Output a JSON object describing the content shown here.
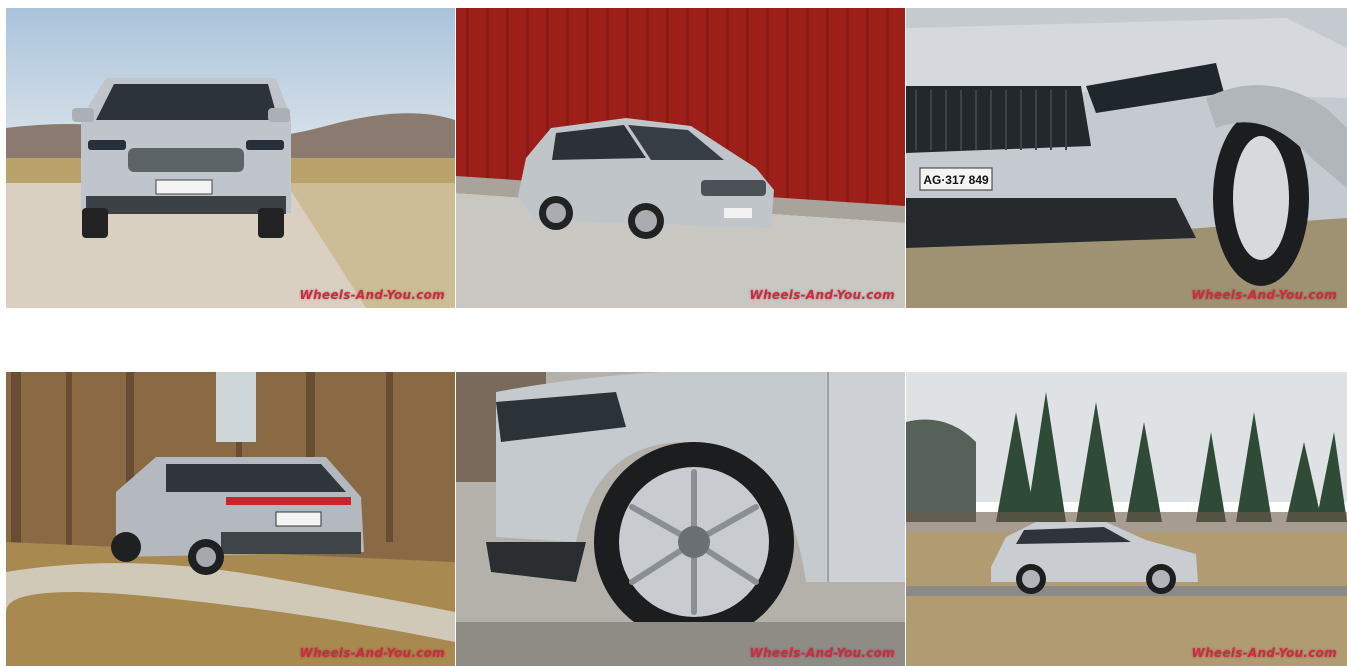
{
  "gallery": {
    "watermark": "Wheels-And-You.com",
    "photos": [
      {
        "subject": "silver SUV front view on gravel road",
        "watermark": "Wheels-And-You.com"
      },
      {
        "subject": "silver SUV three-quarter front view against red wall",
        "watermark": "Wheels-And-You.com"
      },
      {
        "subject": "close-up of front grille and headlight",
        "watermark": "Wheels-And-You.com",
        "plate": "AG·317 849"
      },
      {
        "subject": "silver SUV rear three-quarter view on country road",
        "watermark": "Wheels-And-You.com"
      },
      {
        "subject": "close-up of front wheel and fender",
        "watermark": "Wheels-And-You.com"
      },
      {
        "subject": "silver SUV side profile with forest background",
        "watermark": "Wheels-And-You.com"
      }
    ]
  },
  "colors": {
    "watermark": "#d7263d",
    "car_silver": "#c3c8cd",
    "red_wall": "#9c1f1a"
  }
}
